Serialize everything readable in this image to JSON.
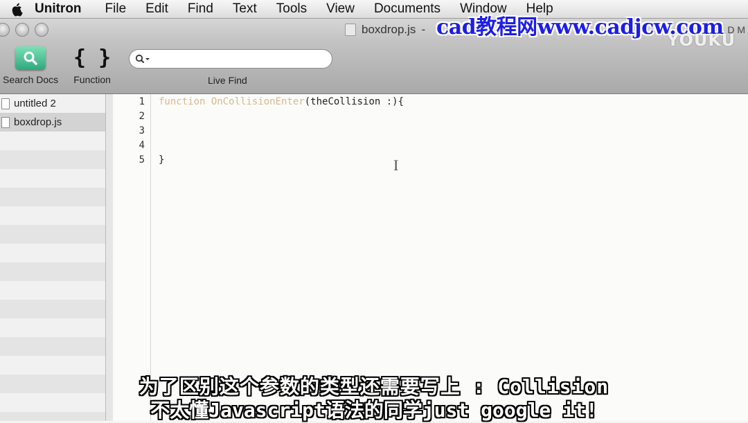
{
  "menubar": {
    "apple_icon": "apple-logo",
    "app_name": "Unitron",
    "items": [
      "File",
      "Edit",
      "Find",
      "Text",
      "Tools",
      "View",
      "Documents",
      "Window",
      "Help"
    ]
  },
  "window": {
    "title": "boxdrop.js",
    "title_suffix": "-",
    "right_fragment": "D M"
  },
  "toolbar": {
    "search_docs_label": "Search Docs",
    "function_label": "Function",
    "function_icon": "{ }",
    "live_find_label": "Live Find",
    "live_find_value": ""
  },
  "sidebar": {
    "items": [
      {
        "label": "untitled 2",
        "selected": false
      },
      {
        "label": "boxdrop.js",
        "selected": true
      }
    ]
  },
  "editor": {
    "line_numbers": [
      "1",
      "2",
      "3",
      "4",
      "5"
    ],
    "line1_keyword": "function",
    "line1_name": "OnCollisionEnter",
    "line1_rest": "(theCollision :){",
    "line5": "}"
  },
  "overlay": {
    "watermark": "cad教程网www.cadjcw.com",
    "youku": "YOUKU",
    "subtitle_line1": "为了区别这个参数的类型还需要写上 : Collision",
    "subtitle_line2": "不太懂Javascript语法的同学just google it!"
  },
  "colors": {
    "keyword": "#d7b98f",
    "watermark": "#1e1ee6",
    "search_docs_icon": "#2fa87c"
  }
}
